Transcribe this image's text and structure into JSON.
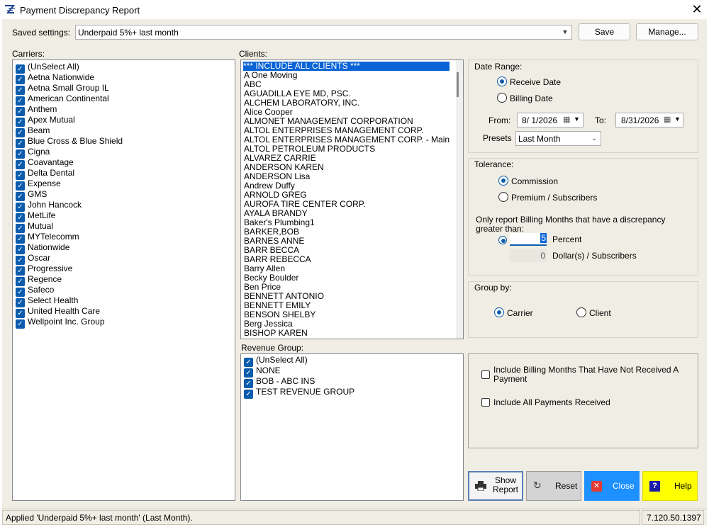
{
  "window": {
    "title": "Payment Discrepancy Report"
  },
  "saved": {
    "label": "Saved settings:",
    "value": "Underpaid 5%+ last month",
    "save_label": "Save",
    "manage_label": "Manage..."
  },
  "carriers": {
    "label": "Carriers:",
    "items": [
      "(UnSelect All)",
      "Aetna Nationwide",
      "Aetna Small Group IL",
      "American Continental",
      "Anthem",
      "Apex Mutual",
      "Beam",
      "Blue Cross & Blue Shield",
      "Cigna",
      "Coavantage",
      "Delta Dental",
      "Expense",
      "GMS",
      "John Hancock",
      "MetLife",
      "Mutual",
      "MYTelecomm",
      "Nationwide",
      "Oscar",
      "Progressive",
      "Regence",
      "Safeco",
      "Select Health",
      "United Health Care",
      "Wellpoint Inc. Group"
    ]
  },
  "clients": {
    "label": "Clients:",
    "items": [
      "*** INCLUDE ALL CLIENTS ***",
      "A One Moving",
      "ABC",
      "AGUADILLA EYE MD, PSC.",
      "ALCHEM LABORATORY, INC.",
      "Alice Cooper",
      "ALMONET MANAGEMENT CORPORATION",
      "ALTOL ENTERPRISES MANAGEMENT CORP.",
      "ALTOL ENTERPRISES MANAGEMENT CORP. - Main",
      "ALTOL PETROLEUM PRODUCTS",
      "ALVAREZ CARRIE",
      "ANDERSON KAREN",
      "ANDERSON Lisa",
      "Andrew Duffy",
      "ARNOLD GREG",
      "AUROFA TIRE CENTER CORP.",
      "AYALA BRANDY",
      "Baker's Plumbing1",
      "BARKER,BOB",
      "BARNES ANNE",
      "BARR BECCA",
      "BARR REBECCA",
      "Barry Allen",
      "Becky Boulder",
      "Ben Price",
      "BENNETT ANTONIO",
      "BENNETT EMILY",
      "BENSON SHELBY",
      "Berg Jessica",
      "BISHOP KAREN"
    ]
  },
  "revenue": {
    "label": "Revenue Group:",
    "items": [
      "(UnSelect All)",
      "NONE",
      "BOB - ABC INS",
      "TEST REVENUE GROUP"
    ]
  },
  "date_range": {
    "title": "Date Range:",
    "receive_label": "Receive Date",
    "billing_label": "Billing Date",
    "from_label": "From:",
    "from_value": "8/  1/2026",
    "to_label": "To:",
    "to_value": "8/31/2026",
    "presets_label": "Presets",
    "presets_value": "Last Month"
  },
  "tolerance": {
    "title": "Tolerance:",
    "commission_label": "Commission",
    "premium_label": "Premium / Subscribers",
    "desc": "Only report Billing Months that have a discrepancy greater than:",
    "percent_value": "5",
    "percent_label": "Percent",
    "dollar_value": "0",
    "dollar_label": "Dollar(s) / Subscribers"
  },
  "group_by": {
    "title": "Group by:",
    "carrier_label": "Carrier",
    "client_label": "Client"
  },
  "options": {
    "not_received_label": "Include Billing Months That Have Not Received A Payment",
    "all_payments_label": "Include All Payments Received"
  },
  "actions": {
    "show_report": "Show Report",
    "reset": "Reset",
    "close": "Close",
    "help": "Help"
  },
  "status": {
    "message": "Applied 'Underpaid 5%+ last month' (Last Month).",
    "version": "7.120.50.1397"
  },
  "colors": {
    "accent": "#0b5cad",
    "close_btn": "#1e90ff",
    "help_btn": "#ffff00",
    "selection": "#0a64d6"
  }
}
